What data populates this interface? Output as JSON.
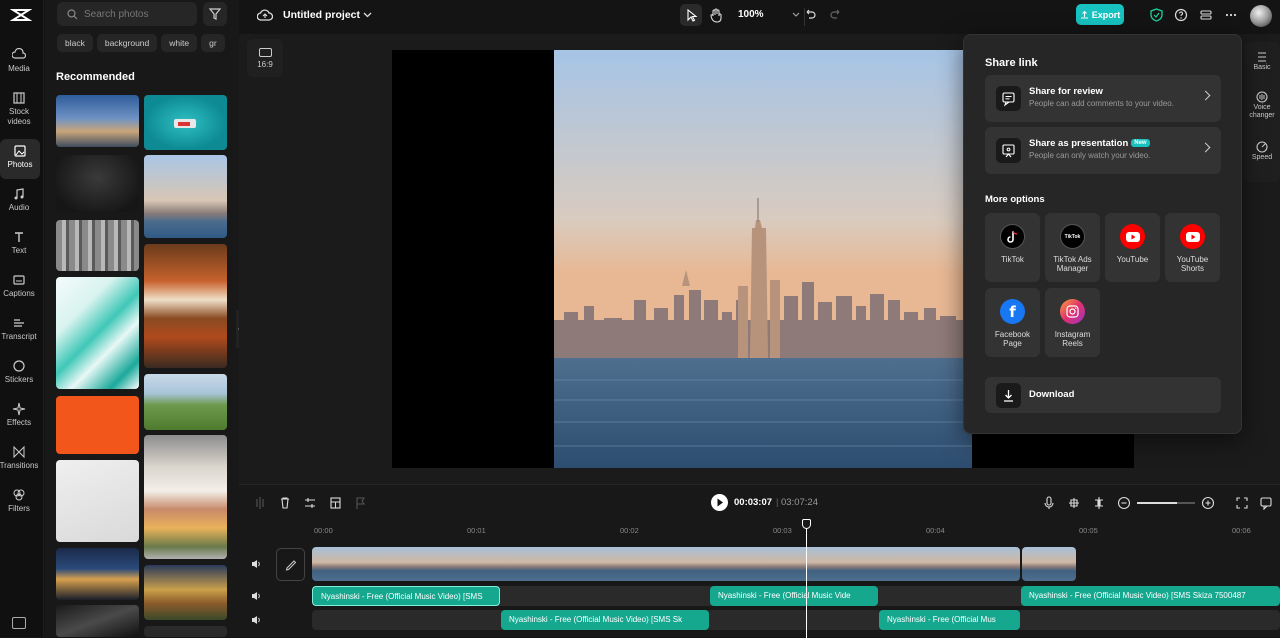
{
  "rail": {
    "items": [
      {
        "label": "Media"
      },
      {
        "label": "Stock videos"
      },
      {
        "label": "Photos"
      },
      {
        "label": "Audio"
      },
      {
        "label": "Text"
      },
      {
        "label": "Captions"
      },
      {
        "label": "Transcript"
      },
      {
        "label": "Stickers"
      },
      {
        "label": "Effects"
      },
      {
        "label": "Transitions"
      },
      {
        "label": "Filters"
      }
    ],
    "active": "Photos"
  },
  "library": {
    "search_placeholder": "Search photos",
    "chips": [
      "black",
      "background",
      "white",
      "gr"
    ],
    "section_title": "Recommended"
  },
  "topbar": {
    "project_title": "Untitled project",
    "zoom": "100%",
    "export_label": "Export"
  },
  "stage": {
    "ratio_label": "16:9"
  },
  "right_rail": {
    "items": [
      "Basic",
      "Voice changer",
      "Speed"
    ]
  },
  "share": {
    "title": "Share link",
    "review_title": "Share for review",
    "review_desc": "People can add comments to your video.",
    "present_title": "Share as presentation",
    "present_badge": "New",
    "present_desc": "People can only watch your video.",
    "more_title": "More options",
    "options": [
      {
        "label": "TikTok",
        "icon": "tiktok-icon",
        "color": "#000000"
      },
      {
        "label": "TikTok Ads Manager",
        "icon": "tiktok-ads-icon",
        "color": "#000000"
      },
      {
        "label": "YouTube",
        "icon": "youtube-icon",
        "color": "#ff0000"
      },
      {
        "label": "YouTube Shorts",
        "icon": "youtube-shorts-icon",
        "color": "#ff0000"
      },
      {
        "label": "Facebook Page",
        "icon": "facebook-icon",
        "color": "#1877f2"
      },
      {
        "label": "Instagram Reels",
        "icon": "instagram-icon",
        "color": "#e1306c"
      }
    ],
    "download_label": "Download"
  },
  "timeline": {
    "current_time": "00:03:07",
    "duration": "03:07:24",
    "ticks": [
      "00:00",
      "00:01",
      "00:02",
      "00:03",
      "00:04",
      "00:05",
      "00:06"
    ],
    "audio_clips": [
      "Nyashinski - Free (Official Music Video) [SMS",
      "Nyashinski - Free (Official Music Vide",
      "Nyashinski - Free (Official Music Video) [SMS Skiza 7500487",
      "Nyashinski - Free (Official Music Video) [SMS Sk",
      "Nyashinski - Free (Official Mus"
    ]
  },
  "colors": {
    "accent": "#17c2c0",
    "audio_clip": "#16a88f"
  }
}
